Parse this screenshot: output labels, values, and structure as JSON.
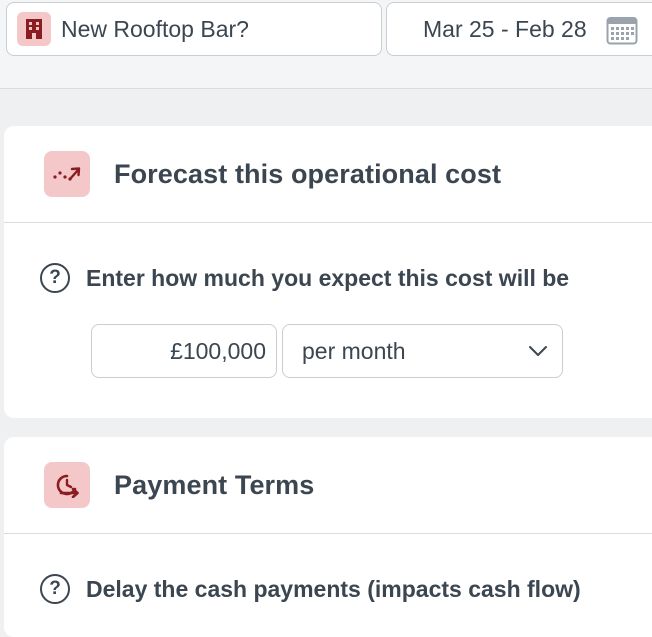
{
  "topbar": {
    "project": {
      "label": "New Rooftop Bar?",
      "icon": "building-icon"
    },
    "date_range": {
      "label": "Mar 25 - Feb 28",
      "icon": "calendar-icon"
    }
  },
  "forecast": {
    "title": "Forecast this operational cost",
    "icon": "trend-up-icon",
    "question": "Enter how much you expect this cost will be",
    "amount": "£100,000",
    "period": "per month"
  },
  "payment_terms": {
    "title": "Payment Terms",
    "icon": "delay-payment-icon",
    "question": "Delay the cash payments (impacts cash flow)"
  },
  "colors": {
    "accent": "#8b1c22",
    "accent_bg": "#f4c7c9",
    "text": "#3b4650",
    "border": "#c9ced3",
    "page_bg": "#eef0f2"
  }
}
